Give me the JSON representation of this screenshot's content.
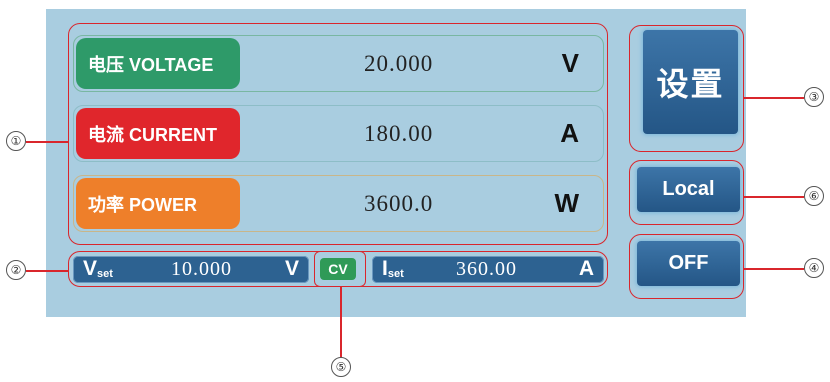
{
  "readouts": [
    {
      "label": "电压 VOLTAGE",
      "value": "20.000",
      "unit": "V",
      "color": "#2e9a69"
    },
    {
      "label": "电流 CURRENT",
      "value": "180.00",
      "unit": "A",
      "color": "#e0262c"
    },
    {
      "label": "功率 POWER",
      "value": "3600.0",
      "unit": "W",
      "color": "#ee7f2a"
    }
  ],
  "vset": {
    "symbol": "V",
    "sub": "set",
    "value": "10.000",
    "unit": "V"
  },
  "mode": "CV",
  "iset": {
    "symbol": "I",
    "sub": "set",
    "value": "360.00",
    "unit": "A"
  },
  "buttons": {
    "settings": "设置",
    "local": "Local",
    "off": "OFF"
  },
  "callouts": [
    "①",
    "②",
    "③",
    "④",
    "⑤",
    "⑥"
  ],
  "colors": {
    "panel": "#a9cde0",
    "button": "#2d6291",
    "annotation": "#d9262c",
    "mode_badge": "#2f9a57"
  }
}
